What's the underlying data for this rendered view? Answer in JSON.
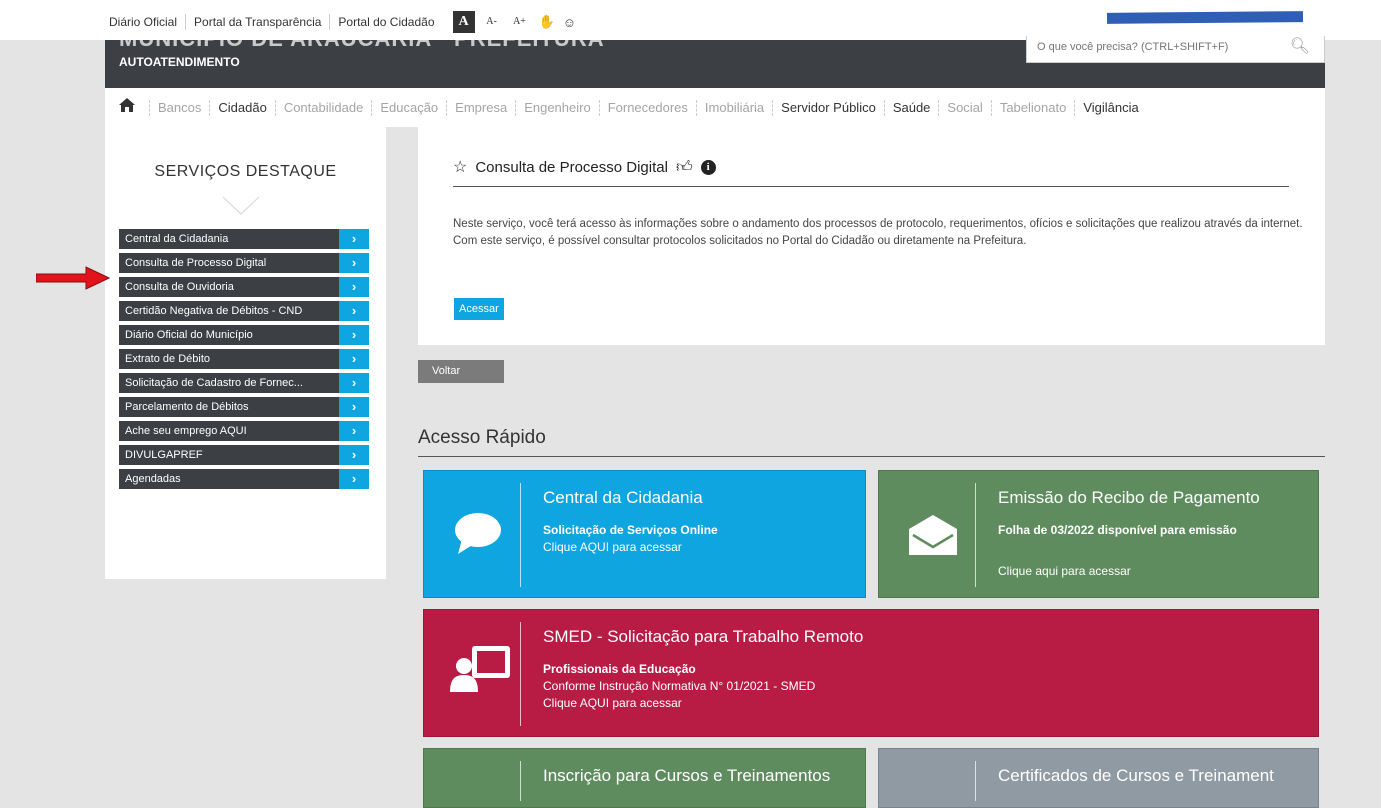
{
  "topbar": {
    "links": [
      "Diário Oficial",
      "Portal da Transparência",
      "Portal do Cidadão"
    ],
    "font_big": "A",
    "font_small": "A-",
    "font_large": "A+"
  },
  "header": {
    "subtitle": "AUTOATENDIMENTO"
  },
  "search": {
    "placeholder": "O que você precisa? (CTRL+SHIFT+F)"
  },
  "categories": [
    {
      "label": "Bancos",
      "active": false
    },
    {
      "label": "Cidadão",
      "active": true
    },
    {
      "label": "Contabilidade",
      "active": false
    },
    {
      "label": "Educação",
      "active": false
    },
    {
      "label": "Empresa",
      "active": false
    },
    {
      "label": "Engenheiro",
      "active": false
    },
    {
      "label": "Fornecedores",
      "active": false
    },
    {
      "label": "Imobiliária",
      "active": false
    },
    {
      "label": "Servidor Público",
      "active": true
    },
    {
      "label": "Saúde",
      "active": true
    },
    {
      "label": "Social",
      "active": false
    },
    {
      "label": "Tabelionato",
      "active": false
    },
    {
      "label": "Vigilância",
      "active": true
    }
  ],
  "sidebar": {
    "title": "SERVIÇOS DESTAQUE",
    "items": [
      "Central da Cidadania",
      "Consulta de Processo Digital",
      "Consulta de Ouvidoria",
      "Certidão Negativa de Débitos - CND",
      "Diário Oficial do Município",
      "Extrato de Débito",
      "Solicitação de Cadastro de Fornec...",
      "Parcelamento de Débitos",
      "Ache seu emprego AQUI",
      "DIVULGAPREF",
      "Agendadas"
    ]
  },
  "service": {
    "title": "Consulta de Processo Digital",
    "description": "Neste serviço, você terá acesso às informações sobre o andamento dos processos de protocolo, requerimentos, ofícios e solicitações que realizou através da internet. Com este serviço, é possível consultar protocolos solicitados no Portal do Cidadão ou diretamente na Prefeitura.",
    "access_label": "Acessar"
  },
  "back_label": "Voltar",
  "quick_access": {
    "title": "Acesso Rápido",
    "tiles": [
      {
        "title": "Central da Cidadania",
        "lines": [
          "Solicitação de Serviços Online",
          "Clique AQUI para acessar"
        ],
        "color": "#0ea5e0"
      },
      {
        "title": "Emissão do Recibo de Pagamento",
        "lines": [
          "Folha de 03/2022 disponível para emissão",
          "Clique aqui para acessar"
        ],
        "color": "#5f8c5f"
      },
      {
        "title": "SMED - Solicitação para Trabalho Remoto",
        "lines": [
          "Profissionais da Educação",
          "Conforme Instrução Normativa N° 01/2021 - SMED",
          "Clique AQUI para acessar"
        ],
        "color": "#b81c45"
      },
      {
        "title": "Inscrição para Cursos e Treinamentos",
        "lines": [],
        "color": "#5f8c5f"
      },
      {
        "title": "Certificados de Cursos e Treinament",
        "lines": [],
        "color": "#8f9aa3"
      }
    ]
  }
}
